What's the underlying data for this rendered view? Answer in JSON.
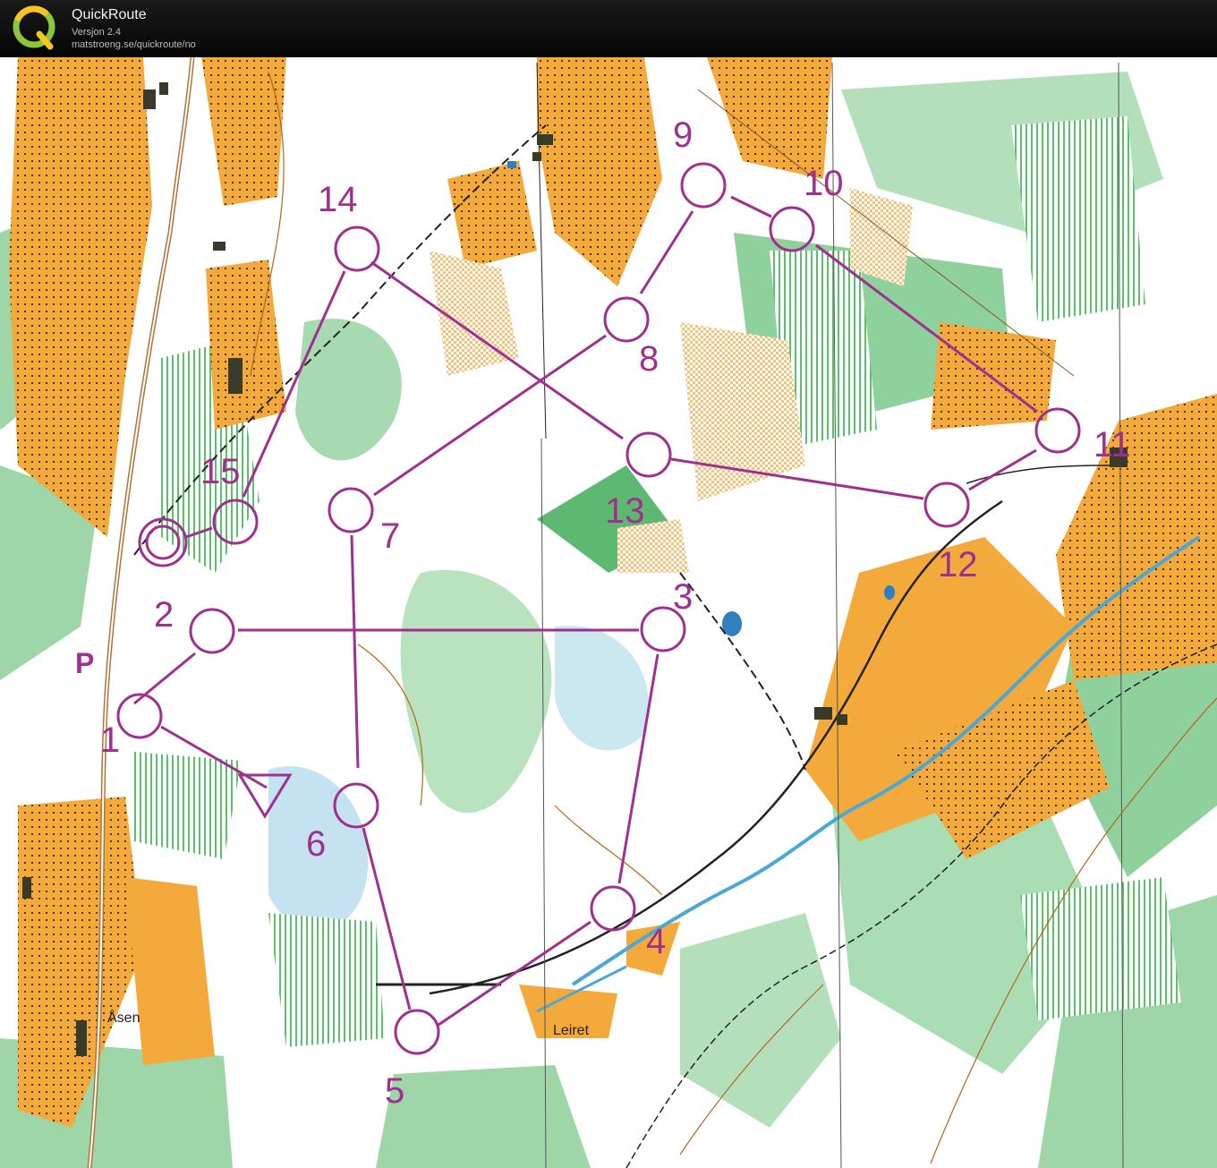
{
  "app": {
    "name": "QuickRoute",
    "version": "Versjon 2.4",
    "url": "matstroeng.se/quickroute/no"
  },
  "map": {
    "place_names": [
      "Åsen",
      "Leiret"
    ],
    "parking_label": "P",
    "course_color": "#a0308f",
    "colors": {
      "open_land": "#f4a93b",
      "rough_open": "#fbd79a",
      "forest_green": "#7cc98a",
      "dark_green": "#3fae5a",
      "water": "#4aa7d8",
      "contour": "#b5651d"
    },
    "controls": [
      {
        "label": "1"
      },
      {
        "label": "2"
      },
      {
        "label": "3"
      },
      {
        "label": "4"
      },
      {
        "label": "5"
      },
      {
        "label": "6"
      },
      {
        "label": "7"
      },
      {
        "label": "8"
      },
      {
        "label": "9"
      },
      {
        "label": "10"
      },
      {
        "label": "11"
      },
      {
        "label": "12"
      },
      {
        "label": "13"
      },
      {
        "label": "14"
      },
      {
        "label": "15"
      }
    ]
  }
}
